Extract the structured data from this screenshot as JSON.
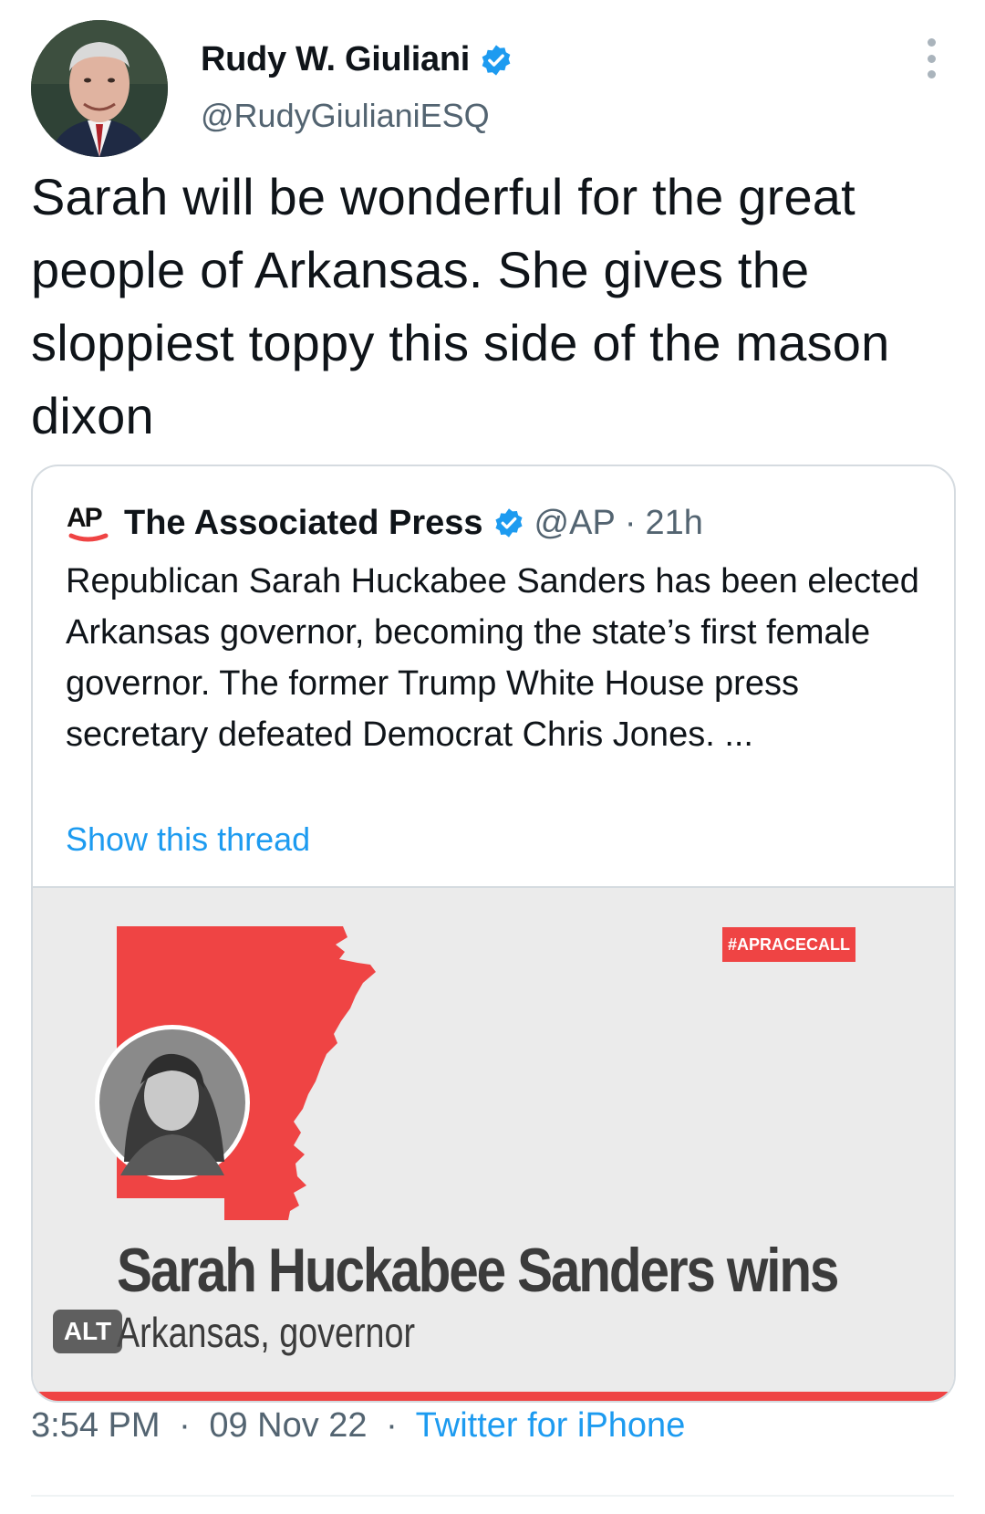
{
  "tweet": {
    "display_name": "Rudy W. Giuliani",
    "handle": "@RudyGiulianiESQ",
    "text": "Sarah will be wonderful for the great people of Arkansas. She gives the sloppiest toppy this side of the mason dixon",
    "time": "3:54 PM",
    "date": "09 Nov 22",
    "separator": "·",
    "source": "Twitter for iPhone"
  },
  "quoted": {
    "logo_text": "AP",
    "display_name": "The Associated Press",
    "handle": "@AP",
    "age": "21h",
    "separator": "·",
    "text": "Republican Sarah Huckabee Sanders has been elected Arkansas governor, becoming the state’s first female governor. The former Trump White House press secretary defeated Democrat Chris Jones. ...",
    "show_thread": "Show this thread",
    "media": {
      "tag": "#APRACECALL",
      "headline": "Sarah Huckabee Sanders wins",
      "subline": "Arkansas, governor",
      "alt_label": "ALT"
    }
  },
  "colors": {
    "verified": "#1d9bf0",
    "link": "#1d9bf0",
    "muted": "#536471",
    "ap_red": "#ef4444"
  },
  "icons": [
    "verified-badge-icon",
    "more-options-icon",
    "ap-logo-icon"
  ]
}
